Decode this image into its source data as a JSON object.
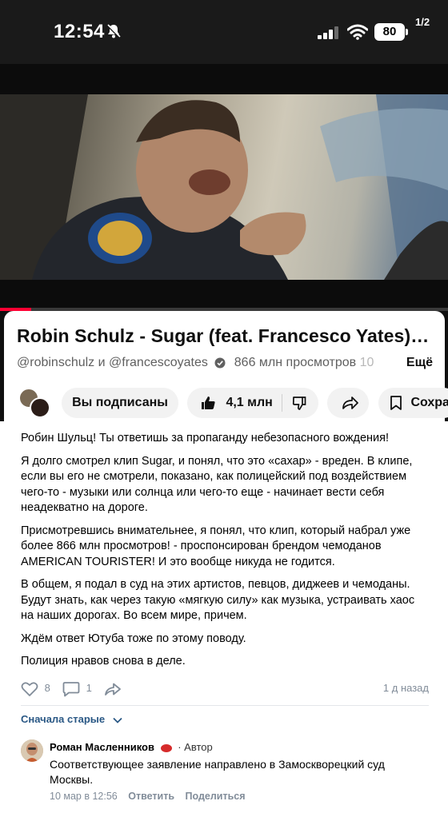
{
  "status_bar": {
    "time": "12:54",
    "battery": "80",
    "page_counter": "1/2"
  },
  "video": {
    "title": "Robin Schulz - Sugar (feat. Francesco Yates)…",
    "channel_part1": "@robinschulz",
    "channel_joiner": " и ",
    "channel_part2": "@francescoyates",
    "views": "866 млн просмотров",
    "views_cut": "10",
    "more": "Ещё",
    "progress_fraction": 0.07
  },
  "actions": {
    "subscribed": "Вы подписаны",
    "likes": "4,1 млн",
    "save": "Сохра"
  },
  "post": {
    "paragraphs": [
      "Робин Шульц! Ты ответишь за пропаганду небезопасного вождения!",
      "Я долго смотрел клип Sugar, и понял, что это «сахар» - вреден. В клипе, если вы его не смотрели, показано, как полицейский под воздействием чего-то - музыки или солнца или чего-то еще - начинает вести себя неадекватно на дороге.",
      "Присмотревшись внимательнее, я понял, что клип, который набрал уже более 866 млн просмотров! - проспонсирован брендом чемоданов AMERICAN TOURISTER! И это вообще никуда не годится.",
      "В общем, я подал в суд на этих артистов, певцов, диджеев и чемоданы. Будут знать, как через такую «мягкую силу» как музыка, устраивать хаос на наших дорогах. Во всем мире, причем.",
      "Ждём ответ Ютуба тоже по этому поводу.",
      "Полиция нравов снова в деле."
    ],
    "likes": "8",
    "comments": "1",
    "time": "1 д назад"
  },
  "comments_section": {
    "sort_label": "Сначала старые",
    "comments": [
      {
        "author": "Роман Масленников",
        "role": "· Автор",
        "text": "Соответствующее заявление направлено в Замоскворецкий суд Москвы.",
        "time": "10 мар в 12:56",
        "reply": "Ответить",
        "share": "Поделиться"
      }
    ]
  },
  "colors": {
    "progress": "#ff0033",
    "link": "#2a5885",
    "muted": "#818c99"
  }
}
